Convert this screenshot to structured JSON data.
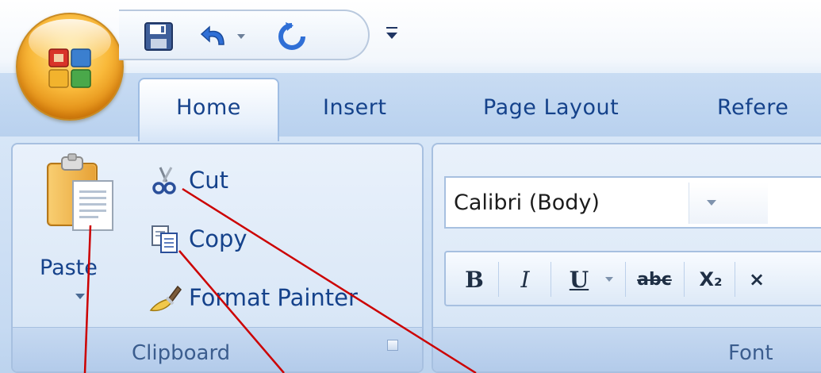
{
  "tabs": [
    "Home",
    "Insert",
    "Page Layout",
    "Refere"
  ],
  "clipboard": {
    "paste_label": "Paste",
    "cut_label": "Cut",
    "copy_label": "Copy",
    "format_painter_label": "Format Painter",
    "group_label": "Clipboard"
  },
  "font": {
    "font_name": "Calibri (Body)",
    "bold_label": "B",
    "italic_label": "I",
    "underline_label": "U",
    "strike_label": "abc",
    "subscript_label": "X₂",
    "group_label": "Font"
  },
  "icons": {
    "office": "office-logo-icon",
    "save": "save-icon",
    "undo": "undo-icon",
    "redo": "redo-icon",
    "customize": "customize-qat-icon",
    "paste": "clipboard-icon",
    "cut": "scissors-icon",
    "copy": "copy-icon",
    "format_painter": "paintbrush-icon",
    "launcher": "dialog-launcher-icon"
  },
  "colors": {
    "accent_text": "#15428b",
    "ribbon_blue": "#c6daf2",
    "orb_orange": "#f9b93a",
    "pointer_red": "#cc0000"
  }
}
